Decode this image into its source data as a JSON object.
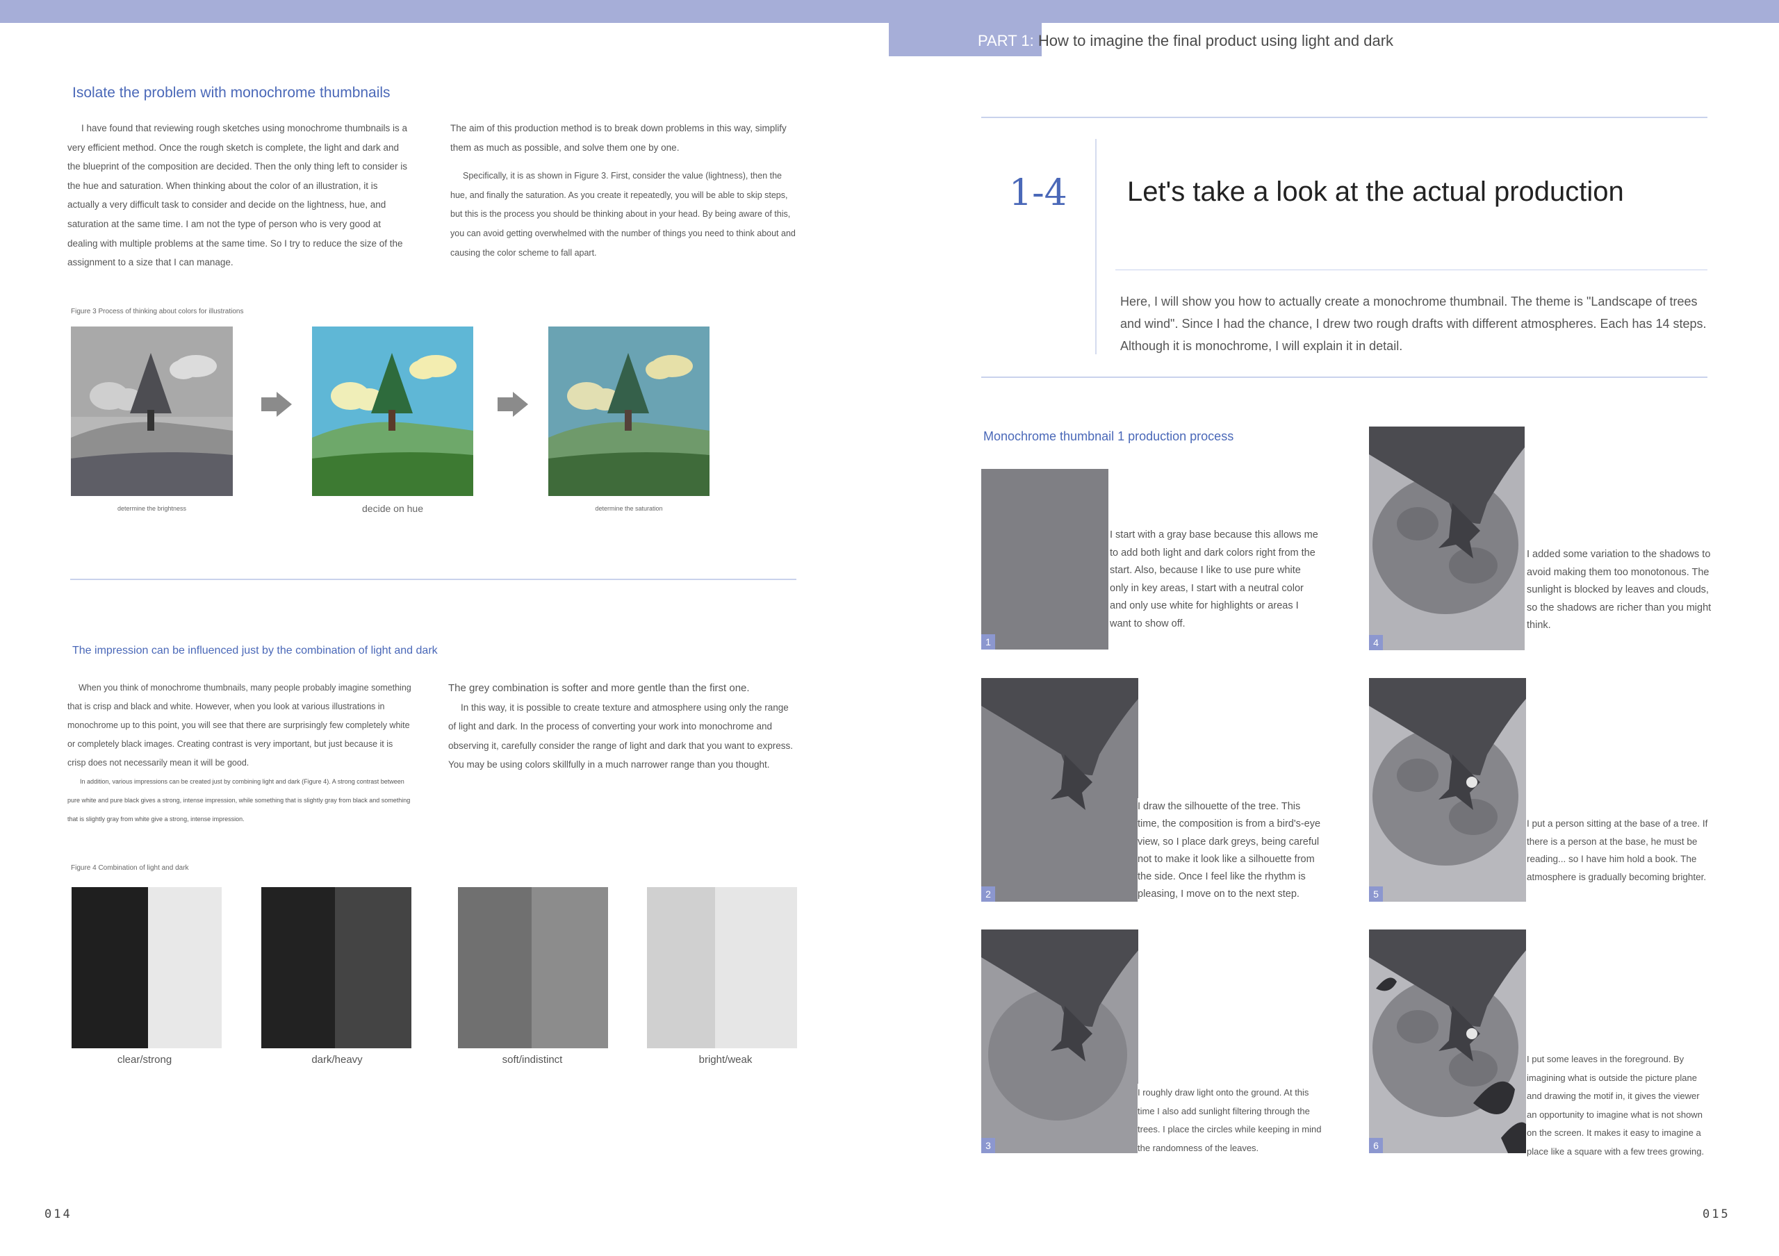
{
  "header": {
    "part_label": "PART 1:",
    "part_title": "How to imagine the final product using light and dark"
  },
  "left_page": {
    "section1": {
      "title": "Isolate the problem with monochrome thumbnails",
      "col1": "I have found that reviewing rough sketches using monochrome thumbnails is a very efficient method. Once the rough sketch is complete, the light and dark and the blueprint of the composition are decided. Then the only thing left to consider is the hue and saturation. When thinking about the color of an illustration, it is actually a very difficult task to consider and decide on the lightness, hue, and saturation at the same time. I am not the type of person who is very good at dealing with multiple problems at the same time. So I try to reduce the size of the assignment to a size that I can manage.",
      "col2_p1": "The aim of this production method is to break down problems in this way, simplify them as much as possible, and solve them one by one.",
      "col2_p2": "Specifically, it is as shown in Figure 3. First, consider the value (lightness), then the hue, and finally the saturation. As you create it repeatedly, you will be able to skip steps, but this is the process you should be thinking about in your head. By being aware of this, you can avoid getting overwhelmed with the number of things you need to think about and causing the color scheme to fall apart."
    },
    "figure3": {
      "caption": "Figure 3 Process of thinking about colors for illustrations",
      "labels": [
        "determine the brightness",
        "decide on hue",
        "determine the saturation"
      ]
    },
    "section2": {
      "title": "The impression can be influenced just by the combination of light and dark",
      "col1_p1": "When you think of monochrome thumbnails, many people probably imagine something that is crisp and black and white. However, when you look at various illustrations in monochrome up to this point, you will see that there are surprisingly few completely white or completely black images. Creating contrast is very important, but just because it is crisp does not necessarily mean it will be good.",
      "col1_p2": "In addition, various impressions can be created just by combining light and dark (Figure 4). A strong contrast between pure white and pure black gives a strong, intense impression, while something that is slightly gray from black and something that is slightly gray from white give a strong, intense impression.",
      "col2_p1": "The grey combination is softer and more gentle than the first one.",
      "col2_p2": "In this way, it is possible to create texture and atmosphere using only the range of light and dark. In the process of converting your work into monochrome and observing it, carefully consider the range of light and dark that you want to express. You may be using colors skillfully in a much narrower range than you thought."
    },
    "figure4": {
      "caption": "Figure 4 Combination of light and dark",
      "labels": [
        "clear/strong",
        "dark/heavy",
        "soft/indistinct",
        "bright/weak"
      ]
    },
    "folio": "014"
  },
  "right_page": {
    "section_number": "1-4",
    "section_title": "Let's take a look at the actual production",
    "intro": "Here, I will show you how to actually create a monochrome thumbnail. The theme is \"Landscape of trees and wind\". Since I had the chance, I drew two rough drafts with different atmospheres. Each has 14 steps. Although it is monochrome, I will explain it in detail.",
    "process_title": "Monochrome thumbnail 1 production process",
    "steps": [
      {
        "num": "1",
        "text": "I start with a gray base because this allows me to add both light and dark colors right from the start. Also, because I like to use pure white only in key areas, I start with a neutral color and only use white for highlights or areas I want to show off."
      },
      {
        "num": "2",
        "text": "I draw the silhouette of the tree. This time, the composition is from a bird's-eye view, so I place dark greys, being careful not to make it look like a silhouette from the side. Once I feel like the rhythm is pleasing, I move on to the next step."
      },
      {
        "num": "3",
        "text": "I roughly draw light onto the ground. At this time I also add sunlight filtering through the trees. I place the circles while keeping in mind the randomness of the leaves."
      },
      {
        "num": "4",
        "text": "I added some variation to the shadows to avoid making them too monotonous. The sunlight is blocked by leaves and clouds, so the shadows are richer than you might think."
      },
      {
        "num": "5",
        "text": "I put a person sitting at the base of a tree. If there is a person at the base, he must be reading... so I have him hold a book. The atmosphere is gradually becoming brighter."
      },
      {
        "num": "6",
        "text": "I put some leaves in the foreground. By imagining what is outside the picture plane and drawing the motif in, it gives the viewer an opportunity to imagine what is not shown on the screen. It makes it easy to imagine a place like a square with a few trees growing."
      }
    ],
    "folio": "015"
  },
  "colors": {
    "accent_bar": "#a6aed8",
    "heading_blue": "#4a68b8",
    "badge": "#8c97cf"
  }
}
